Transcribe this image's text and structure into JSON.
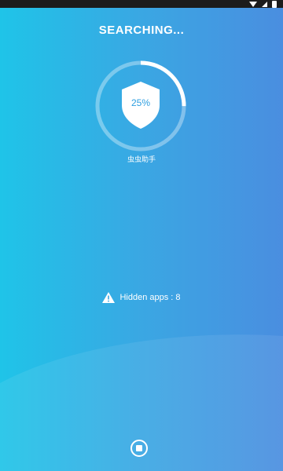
{
  "status_bar": {
    "icons": [
      "wifi-icon",
      "signal-icon",
      "battery-icon"
    ]
  },
  "header": {
    "title": "SEARCHING..."
  },
  "scan": {
    "progress_percent": 25,
    "percent_label": "25%",
    "app_name": "虫虫助手"
  },
  "result": {
    "warning_icon": "warning-icon",
    "hidden_apps_text": "Hidden apps : 8"
  },
  "controls": {
    "stop_icon": "stop-icon"
  },
  "colors": {
    "gradient_start": "#1fc4e8",
    "gradient_end": "#4a8ee0",
    "shield_fill": "#ffffff",
    "percent_text": "#2f9fe0",
    "progress_ring": "#ffffff",
    "ring_track": "#8fd3f2"
  }
}
